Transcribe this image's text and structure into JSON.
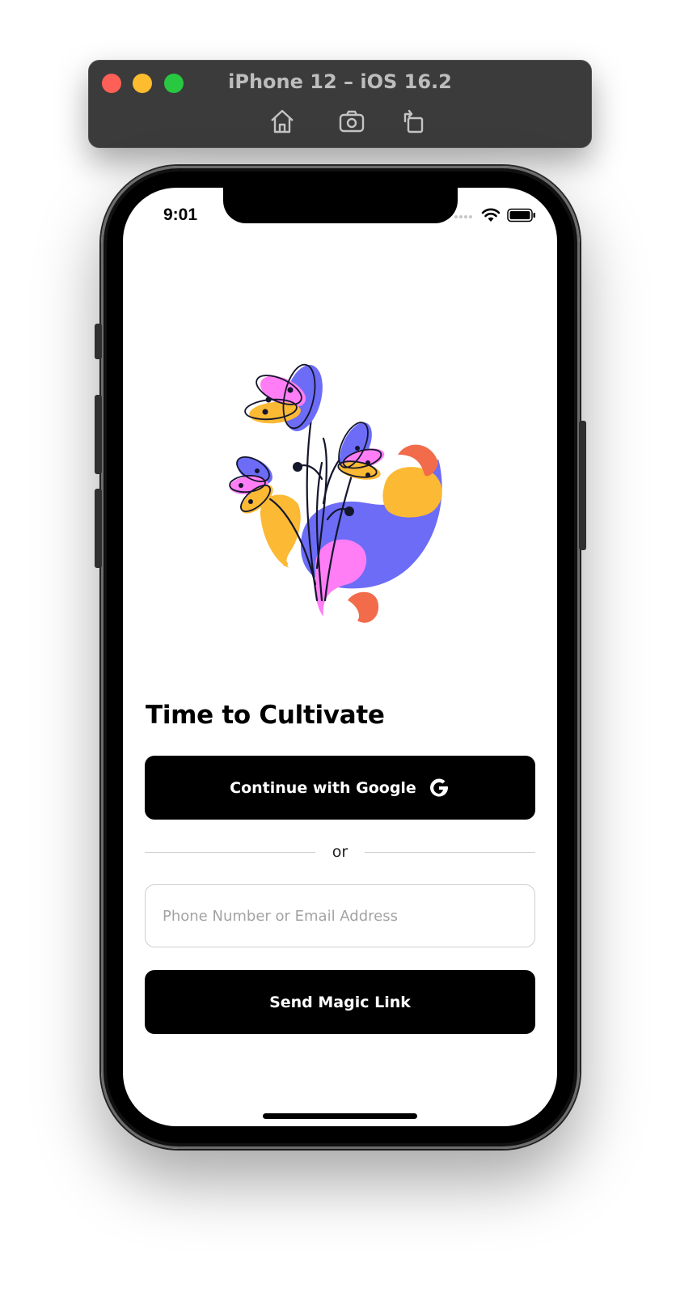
{
  "simulator": {
    "title": "iPhone 12 – iOS 16.2",
    "toolbar": [
      "home-icon",
      "screenshot-icon",
      "rotate-icon"
    ]
  },
  "status_bar": {
    "time": "9:01",
    "icons": [
      "cellular-icon",
      "wifi-icon",
      "battery-icon"
    ]
  },
  "screen": {
    "title": "Time to Cultivate",
    "google_button_label": "Continue with Google",
    "divider_text": "or",
    "contact_input": {
      "placeholder": "Phone Number or Email Address",
      "value": ""
    },
    "magic_link_button_label": "Send Magic Link"
  },
  "colors": {
    "primary_button": "#000000",
    "illustration_purple": "#6c6cf7",
    "illustration_pink": "#ff7ef5",
    "illustration_yellow": "#fbb934",
    "illustration_coral": "#f26b4a"
  }
}
